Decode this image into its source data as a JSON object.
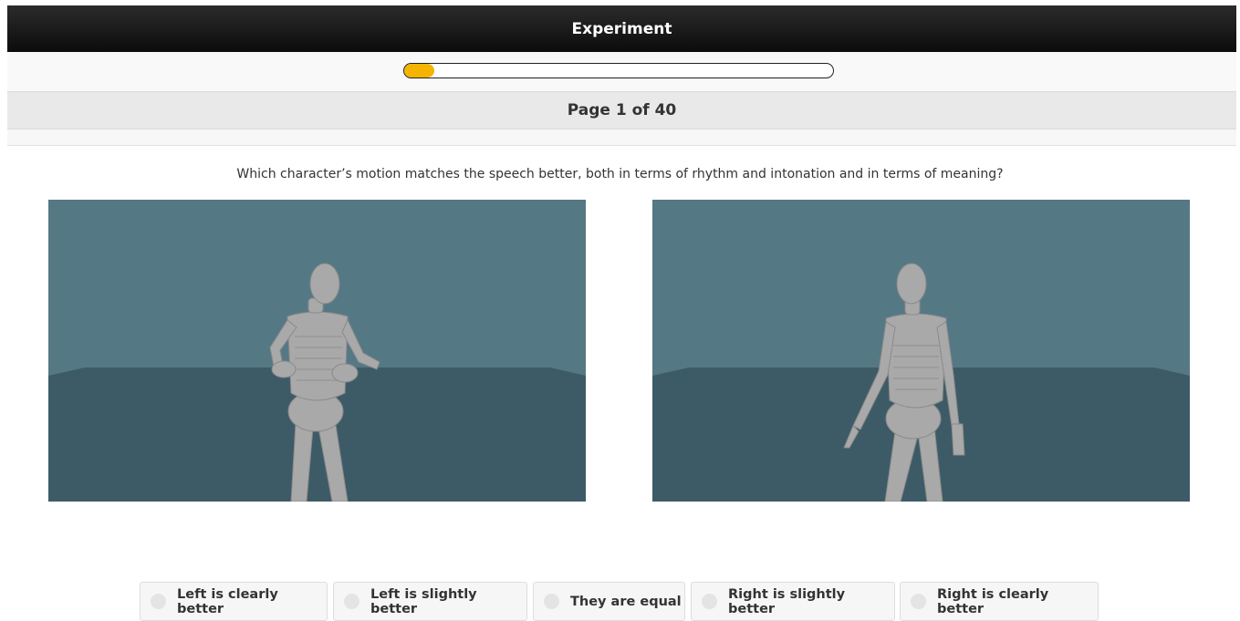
{
  "header": {
    "title": "Experiment"
  },
  "progress": {
    "fraction": 0.07,
    "color": "#f4b400"
  },
  "pagination": {
    "text": "Page 1 of 40"
  },
  "question": {
    "text": "Which character’s motion matches the speech better, both in terms of rhythm and intonation and in terms of meaning?"
  },
  "videos": [
    {
      "name": "left",
      "pose": "hands on hips"
    },
    {
      "name": "right",
      "pose": "arms down"
    }
  ],
  "options": [
    {
      "label": "Left is clearly better"
    },
    {
      "label": "Left is slightly better"
    },
    {
      "label": "They are equal"
    },
    {
      "label": "Right is slightly better"
    },
    {
      "label": "Right is clearly better"
    }
  ],
  "colors": {
    "scene_wall": "#557885",
    "scene_floor": "#3d5b66",
    "accent": "#f4b400"
  }
}
